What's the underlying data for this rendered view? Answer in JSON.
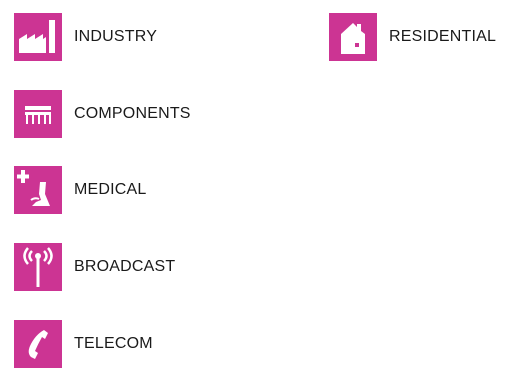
{
  "colors": {
    "tile": "#cc3493",
    "icon": "#ffffff",
    "text": "#1a1a1a"
  },
  "categories": [
    {
      "key": "industry",
      "label": "INDUSTRY",
      "icon": "factory-icon"
    },
    {
      "key": "residential",
      "label": "RESIDENTIAL",
      "icon": "house-icon"
    },
    {
      "key": "components",
      "label": "COMPONENTS",
      "icon": "circuit-component-icon"
    },
    {
      "key": "medical",
      "label": "MEDICAL",
      "icon": "medical-microscope-icon"
    },
    {
      "key": "broadcast",
      "label": "BROADCAST",
      "icon": "broadcast-antenna-icon"
    },
    {
      "key": "telecom",
      "label": "TELECOM",
      "icon": "telephone-handset-icon"
    }
  ]
}
